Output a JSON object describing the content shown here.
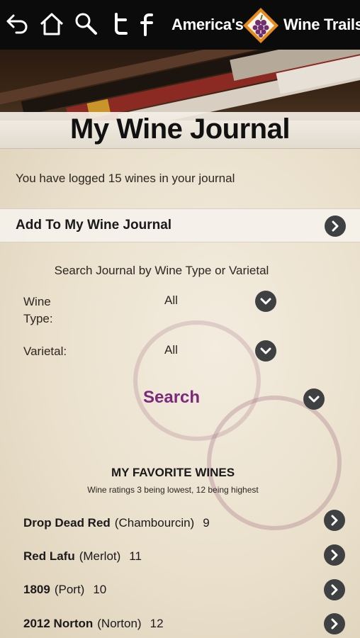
{
  "header": {
    "brand_left": "America's",
    "brand_right": "Wine Trails",
    "icons": [
      "back-arrow-icon",
      "home-icon",
      "search-icon",
      "twitter-icon",
      "facebook-icon"
    ]
  },
  "page_title": "My Wine Journal",
  "logged_text": "You have logged 15 wines in your journal",
  "add_label": "Add To My Wine Journal",
  "search": {
    "caption": "Search Journal by Wine Type or Varietal",
    "wine_type_label": "Wine\nType:",
    "wine_type_value": "All",
    "varietal_label": "Varietal:",
    "varietal_value": "All",
    "search_label": "Search"
  },
  "favorites": {
    "title": "MY FAVORITE WINES",
    "subtitle": "Wine ratings 3 being lowest, 12 being highest",
    "items": [
      {
        "name": "Drop Dead Red",
        "varietal": "(Chambourcin)",
        "rating": "9"
      },
      {
        "name": "Red Lafu",
        "varietal": "(Merlot)",
        "rating": "11"
      },
      {
        "name": "1809",
        "varietal": "(Port)",
        "rating": "10"
      },
      {
        "name": "2012 Norton",
        "varietal": "(Norton)",
        "rating": "12"
      }
    ]
  },
  "colors": {
    "accent_purple": "#7b2a7b",
    "button_gray": "#3f4042",
    "topbar": "#0b0b0b"
  }
}
